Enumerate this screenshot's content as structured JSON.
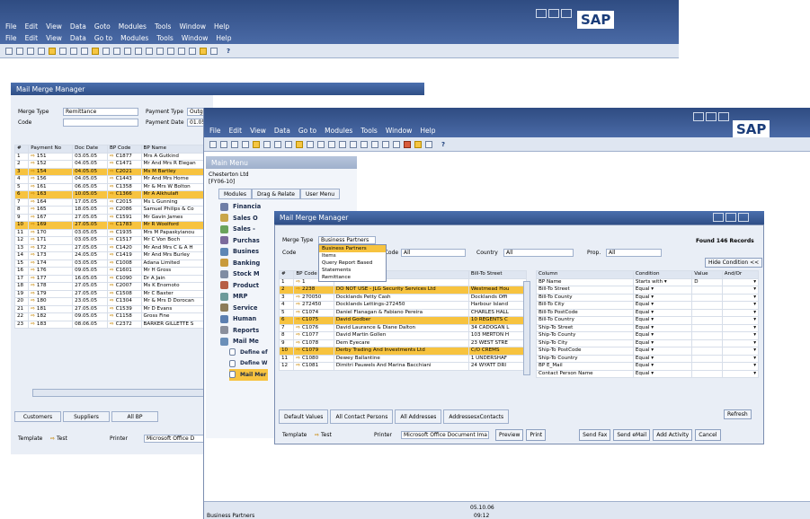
{
  "back": {
    "menu1": [
      "File",
      "Edit",
      "View",
      "Data",
      "Goto",
      "Modules",
      "Tools",
      "Window",
      "Help"
    ],
    "menu2": [
      "File",
      "Edit",
      "View",
      "Data",
      "Go to",
      "Modules",
      "Tools",
      "Window",
      "Help"
    ],
    "logo": "SAP",
    "window_title": "Mail Merge Manager",
    "merge_type_label": "Merge Type",
    "merge_type_value": "Remittance",
    "payment_type_label": "Payment Type",
    "payment_type_value": "Outgo",
    "code_label": "Code",
    "payment_date_label": "Payment Date",
    "payment_date_value": "01.05",
    "columns": [
      "#",
      "Payment No",
      "Doc Date",
      "BP Code",
      "BP Name"
    ],
    "rows": [
      [
        "1",
        "151",
        "03.05.05",
        "C1877",
        "Mrs A Gutkind"
      ],
      [
        "2",
        "152",
        "04.05.05",
        "C1471",
        "Mr And Mrs R Elegan"
      ],
      [
        "3",
        "154",
        "04.05.05",
        "C2021",
        "Ms M Bartley"
      ],
      [
        "4",
        "156",
        "04.05.05",
        "C1443",
        "Mr And Mrs Horne"
      ],
      [
        "5",
        "161",
        "06.05.05",
        "C1358",
        "Mr & Mrs W Bolton"
      ],
      [
        "6",
        "163",
        "10.05.05",
        "C1366",
        "Mr A Alkhulafi"
      ],
      [
        "7",
        "164",
        "17.05.05",
        "C2015",
        "Ms L Gunning"
      ],
      [
        "8",
        "165",
        "18.05.05",
        "C2086",
        "Samuel Philips & Co"
      ],
      [
        "9",
        "167",
        "27.05.05",
        "C1591",
        "Mr Gavin James"
      ],
      [
        "10",
        "169",
        "27.05.05",
        "C1783",
        "Mr R Woolford"
      ],
      [
        "11",
        "170",
        "03.05.05",
        "C1935",
        "Mrs M Papaskyianou"
      ],
      [
        "12",
        "171",
        "03.05.05",
        "C1517",
        "Mr C Von Boch"
      ],
      [
        "13",
        "172",
        "27.05.05",
        "C1420",
        "Mr And Mrs C & A H"
      ],
      [
        "14",
        "173",
        "24.05.05",
        "C1419",
        "Mr And Mrs Burley"
      ],
      [
        "15",
        "174",
        "03.05.05",
        "C1008",
        "Adana Limited"
      ],
      [
        "16",
        "176",
        "09.05.05",
        "C1601",
        "Mr H Gross"
      ],
      [
        "17",
        "177",
        "16.05.05",
        "C1090",
        "Dr A Jain"
      ],
      [
        "18",
        "178",
        "27.05.05",
        "C2007",
        "Ms K Enomoto"
      ],
      [
        "19",
        "179",
        "27.05.05",
        "C1508",
        "Mr C Baxter"
      ],
      [
        "20",
        "180",
        "23.05.05",
        "C1304",
        "Mr & Mrs D Dorocan"
      ],
      [
        "21",
        "181",
        "27.05.05",
        "C1539",
        "Mr D Evans"
      ],
      [
        "22",
        "182",
        "09.05.05",
        "C1158",
        "Gross Fine"
      ],
      [
        "23",
        "183",
        "08.06.05",
        "C2372",
        "BARKER GILLETTE S"
      ]
    ],
    "tabs": [
      "Customers",
      "Suppliers",
      "All BP"
    ],
    "template_label": "Template",
    "template_value": "Test",
    "printer_label": "Printer",
    "printer_value": "Microsoft Office D"
  },
  "front": {
    "menu": [
      "File",
      "Edit",
      "View",
      "Data",
      "Go to",
      "Modules",
      "Tools",
      "Window",
      "Help"
    ],
    "logo": "SAP",
    "main_menu_title": "Main Menu",
    "company": "Chesterton Ltd",
    "company_code": "[FY06-10]",
    "menu_tabs": [
      "Modules",
      "Drag & Relate",
      "User Menu"
    ],
    "modules": [
      {
        "label": "Financia",
        "color": "#6f7ea6"
      },
      {
        "label": "Sales O",
        "color": "#c9a64a"
      },
      {
        "label": "Sales -",
        "color": "#6aa35c"
      },
      {
        "label": "Purchas",
        "color": "#7b6a9c"
      },
      {
        "label": "Busines",
        "color": "#5d86b5"
      },
      {
        "label": "Banking",
        "color": "#c89a3c"
      },
      {
        "label": "Stock M",
        "color": "#7f8ca3"
      },
      {
        "label": "Product",
        "color": "#b65e45"
      },
      {
        "label": "MRP",
        "color": "#6d9a9a"
      },
      {
        "label": "Service",
        "color": "#8d7c5a"
      },
      {
        "label": "Human",
        "color": "#5c7fb0"
      },
      {
        "label": "Reports",
        "color": "#8a8f9c"
      },
      {
        "label": "Mail Me",
        "color": "#6b8fb8"
      }
    ],
    "sub_items": [
      "Define ef",
      "Define W",
      "Mail Mer"
    ],
    "status_left": "Business Partners",
    "status_date": "05.10.06",
    "status_time": "09:12"
  },
  "dialog": {
    "title": "Mail Merge Manager",
    "merge_type_label": "Merge Type",
    "merge_type_value": "Business Partners",
    "code_label": "Code",
    "group_code_label": "p Code",
    "group_code_value": "All",
    "country_label": "Country",
    "country_value": "All",
    "prop_label": "Prop.",
    "prop_value": "All",
    "found": "Found 146 Records",
    "dropdown": [
      "Business Partners",
      "Items",
      "Query Report Based",
      "Statements",
      "Remittance"
    ],
    "hide_condition": "Hide Condition <<",
    "list_cols": [
      "#",
      "BP Code",
      "",
      "Bill-To Street"
    ],
    "list_rows": [
      [
        "1",
        "1",
        "",
        ""
      ],
      [
        "2",
        "2238",
        "DO NOT USE - JLG Security Services Ltd",
        "Westmead Hou"
      ],
      [
        "3",
        "270050",
        "Docklands Petty Cash",
        "Docklands Offi"
      ],
      [
        "4",
        "272450",
        "Docklands Lettings-272450",
        "Harbour Island"
      ],
      [
        "5",
        "C1074",
        "Daniel Flanagan & Fabiano Pereira",
        "CHARLES HALL"
      ],
      [
        "6",
        "C1075",
        "David Godber",
        "10 REGENTS C"
      ],
      [
        "7",
        "C1076",
        "David Laurance & Diane Dalton",
        "34 CADOGAN L"
      ],
      [
        "8",
        "C1077",
        "David Martin Gollen",
        "103 MERTON H"
      ],
      [
        "9",
        "C1078",
        "Dem Eyecare",
        "23 WEST STRE"
      ],
      [
        "10",
        "C1079",
        "Derby Trading And Investments Ltd",
        "C/O CREMS"
      ],
      [
        "11",
        "C1080",
        "Dewey Ballantine",
        "1 UNDERSHAF"
      ],
      [
        "12",
        "C1081",
        "Dimitri Pauwels And Marina Bacchiani",
        "24 WYATT DRI"
      ]
    ],
    "cond_cols": [
      "Column",
      "Condition",
      "Value",
      "And/Or"
    ],
    "cond_rows": [
      [
        "BP Name",
        "Starts with",
        "D"
      ],
      [
        "Bill-To Street",
        "Equal",
        ""
      ],
      [
        "Bill-To County",
        "Equal",
        ""
      ],
      [
        "Bill-To City",
        "Equal",
        ""
      ],
      [
        "Bill-To PostCode",
        "Equal",
        ""
      ],
      [
        "Bill-To Country",
        "Equal",
        ""
      ],
      [
        "Ship-To Street",
        "Equal",
        ""
      ],
      [
        "Ship-To County",
        "Equal",
        ""
      ],
      [
        "Ship-To City",
        "Equal",
        ""
      ],
      [
        "Ship-To PostCode",
        "Equal",
        ""
      ],
      [
        "Ship-To Country",
        "Equal",
        ""
      ],
      [
        "BP E_Mail",
        "Equal",
        ""
      ],
      [
        "Contact Person Name",
        "Equal",
        ""
      ]
    ],
    "tabs": [
      "Default Values",
      "All Contact Persons",
      "All Addresses",
      "AddressesxContacts"
    ],
    "refresh": "Refresh",
    "template_label": "Template",
    "template_value": "Test",
    "printer_label": "Printer",
    "printer_value": "Microsoft Office Document Ima",
    "buttons": [
      "Preview",
      "Print",
      "Send Fax",
      "Send eMail",
      "Add Activity",
      "Cancel"
    ]
  }
}
